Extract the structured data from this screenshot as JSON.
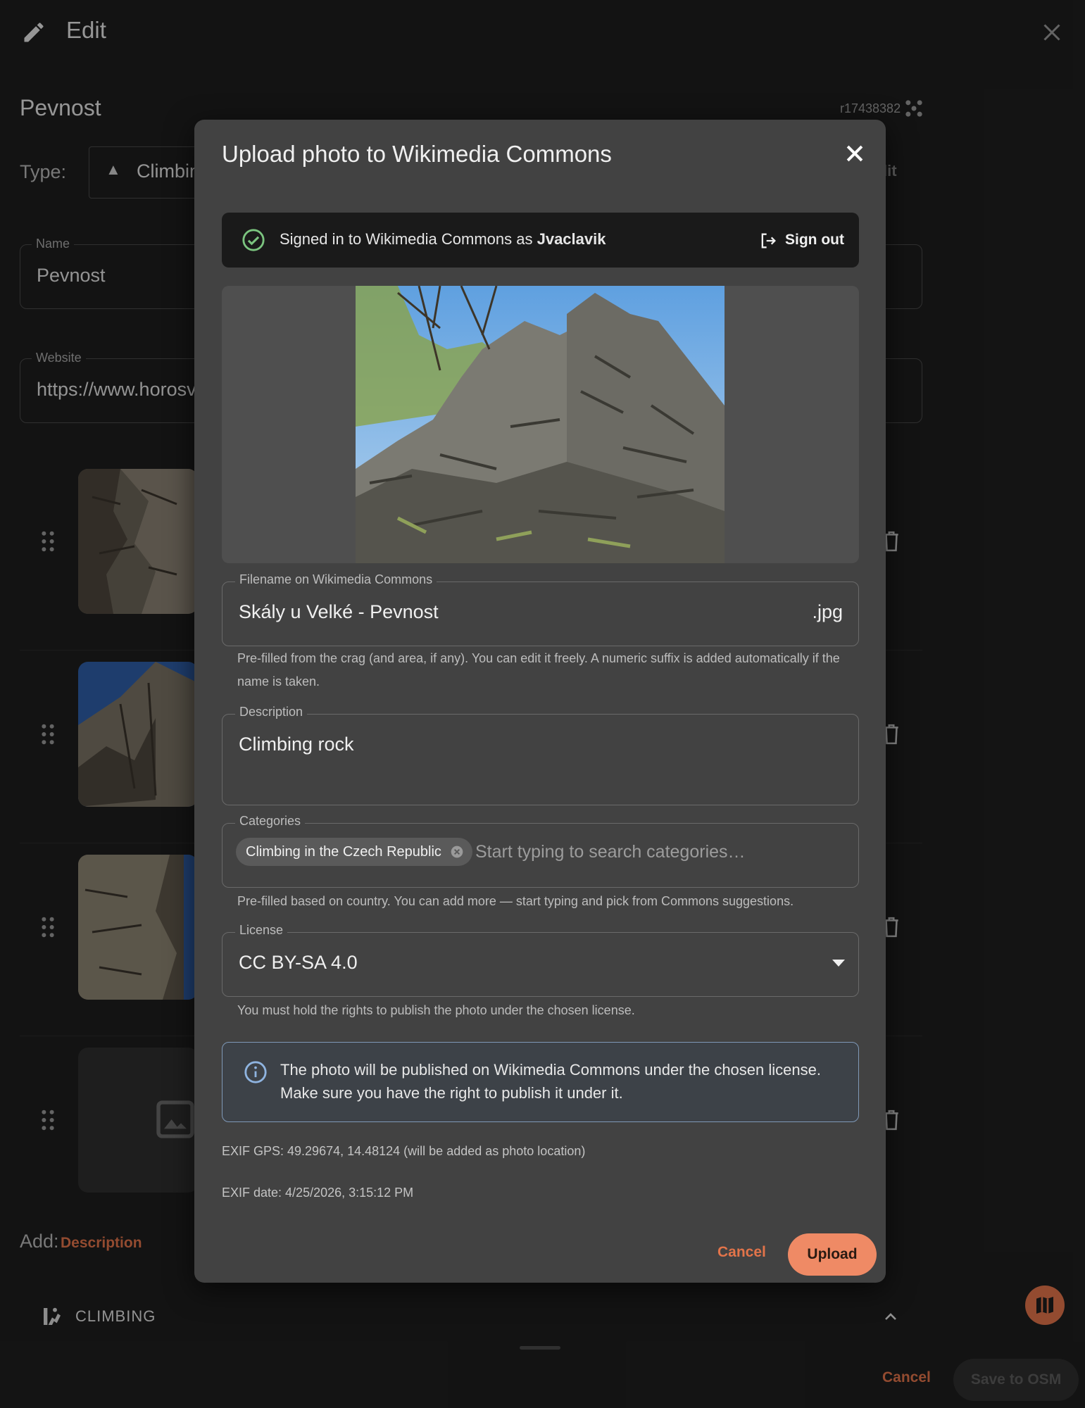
{
  "header": {
    "title": "Edit"
  },
  "feature": {
    "name": "Pevnost",
    "osm_id": "r17438382",
    "type_label": "Type:",
    "type_value": "Climbin",
    "type_edit": "Edit"
  },
  "fields": {
    "name": {
      "label": "Name",
      "value": "Pevnost"
    },
    "website": {
      "label": "Website",
      "value": "https://www.horosva"
    }
  },
  "add": {
    "label": "Add:",
    "description_link": "Description"
  },
  "section": {
    "label": "CLIMBING"
  },
  "footer": {
    "cancel": "Cancel",
    "save": "Save to OSM"
  },
  "modal": {
    "title": "Upload photo to Wikimedia Commons",
    "signin": {
      "prefix": "Signed in to Wikimedia Commons as ",
      "user": "Jvaclavik",
      "sign_out": "Sign out"
    },
    "filename": {
      "label": "Filename on Wikimedia Commons",
      "value": "Skály u Velké - Pevnost",
      "suffix": ".jpg",
      "helper": "Pre-filled from the crag (and area, if any). You can edit it freely. A numeric suffix is added automatically if the name is taken."
    },
    "description": {
      "label": "Description",
      "value": "Climbing rock"
    },
    "categories": {
      "label": "Categories",
      "chips": [
        "Climbing in the Czech Republic"
      ],
      "placeholder": "Start typing to search categories…",
      "helper": "Pre-filled based on country. You can add more — start typing and pick from Commons suggestions."
    },
    "license": {
      "label": "License",
      "value": "CC BY-SA 4.0",
      "helper": "You must hold the rights to publish the photo under the chosen license."
    },
    "info": "The photo will be published on Wikimedia Commons under the chosen license. Make sure you have the right to publish it under it.",
    "exif_gps": "EXIF GPS: 49.29674, 14.48124 (will be added as photo location)",
    "exif_date": "EXIF date: 4/25/2026, 3:15:12 PM",
    "cancel": "Cancel",
    "upload": "Upload"
  },
  "colors": {
    "accent": "#e2744a",
    "upload_button": "#ef8a65",
    "modal_bg": "#424242",
    "page_bg": "#1e1e1e",
    "info_border": "#7f99b8"
  },
  "icons": [
    "edit-icon",
    "close-icon",
    "osm-relation-icon",
    "check-circle-icon",
    "sign-out-icon",
    "chip-remove-icon",
    "dropdown-arrow-icon",
    "info-icon",
    "drag-handle-icon",
    "trash-icon",
    "image-placeholder-icon",
    "climbing-icon",
    "chevron-up-icon",
    "map-icon"
  ]
}
